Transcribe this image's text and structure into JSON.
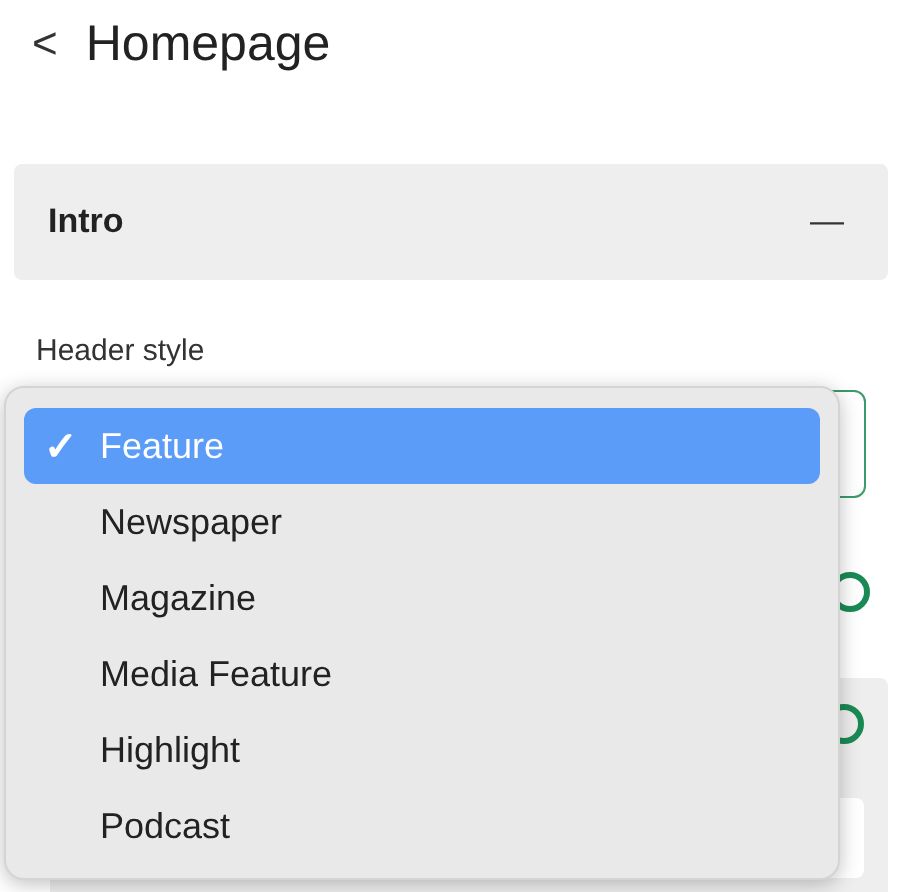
{
  "header": {
    "back": "<",
    "title": "Homepage"
  },
  "section": {
    "title": "Intro",
    "expanded": true,
    "toggle": "—"
  },
  "field": {
    "label": "Header style"
  },
  "dropdown": {
    "check": "✓",
    "options": [
      {
        "label": "Feature",
        "selected": true
      },
      {
        "label": "Newspaper",
        "selected": false
      },
      {
        "label": "Magazine",
        "selected": false
      },
      {
        "label": "Media Feature",
        "selected": false
      },
      {
        "label": "Highlight",
        "selected": false
      },
      {
        "label": "Podcast",
        "selected": false
      }
    ]
  }
}
